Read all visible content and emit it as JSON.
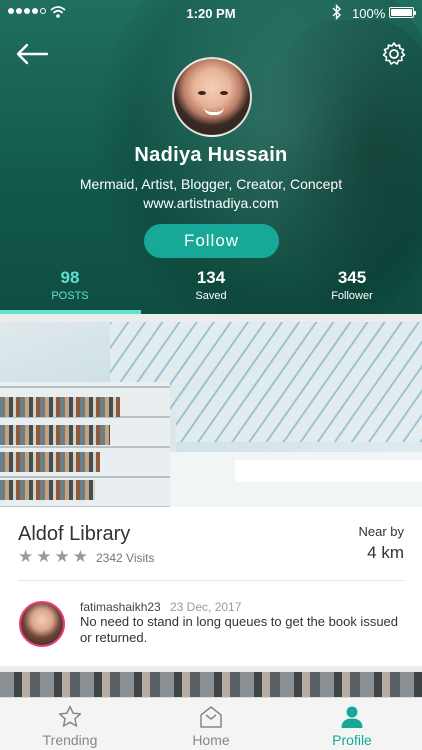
{
  "status_bar": {
    "time": "1:20 PM",
    "battery": "100%",
    "signal_bars": 4
  },
  "profile": {
    "name": "Nadiya Hussain",
    "bio": "Mermaid, Artist, Blogger, Creator, Concept",
    "website": "www.artistnadiya.com",
    "follow_label": "Follow",
    "accent_color": "#17a898",
    "header_color": "#1a6657"
  },
  "stats": [
    {
      "value": "98",
      "label": "POSTS",
      "active": true
    },
    {
      "value": "134",
      "label": "Saved",
      "active": false
    },
    {
      "value": "345",
      "label": "Follower",
      "active": false
    }
  ],
  "post": {
    "place_name": "Aldof Library",
    "visits": "2342 Visits",
    "rating": 4,
    "near_label": "Near by",
    "near_value": "4 km",
    "comment": {
      "user": "fatimashaikh23",
      "date": "23 Dec, 2017",
      "text": "No need to stand in long queues to get the book issued or returned."
    }
  },
  "bottom_nav": [
    {
      "label": "Trending",
      "icon": "star-outline-icon",
      "active": false
    },
    {
      "label": "Home",
      "icon": "home-icon",
      "active": false
    },
    {
      "label": "Profile",
      "icon": "person-icon",
      "active": true
    }
  ]
}
